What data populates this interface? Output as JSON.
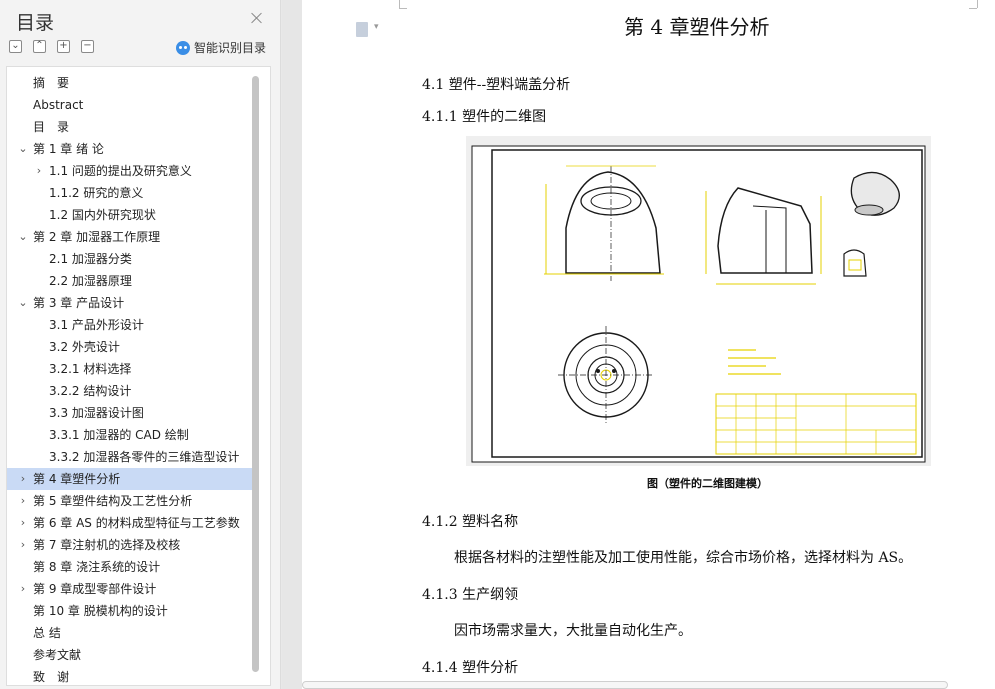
{
  "sidebar": {
    "title": "目录",
    "smart_toc_label": "智能识别目录",
    "tool_icons": [
      "collapse-all-icon",
      "expand-all-icon",
      "add-icon",
      "remove-icon"
    ],
    "items": [
      {
        "label": "摘　要",
        "level": 1,
        "toggle": "none"
      },
      {
        "label": "Abstract",
        "level": 1,
        "toggle": "none"
      },
      {
        "label": "目　录",
        "level": 1,
        "toggle": "none"
      },
      {
        "label": "第 1 章  绪  论",
        "level": 1,
        "toggle": "expanded"
      },
      {
        "label": "1.1 问题的提出及研究意义",
        "level": 2,
        "toggle": "collapsed"
      },
      {
        "label": "1.1.2 研究的意义",
        "level": 2,
        "toggle": "none"
      },
      {
        "label": "1.2 国内外研究现状",
        "level": 2,
        "toggle": "none"
      },
      {
        "label": "第 2 章  加湿器工作原理",
        "level": 1,
        "toggle": "expanded"
      },
      {
        "label": "2.1 加湿器分类",
        "level": 2,
        "toggle": "none"
      },
      {
        "label": "2.2 加湿器原理",
        "level": 2,
        "toggle": "none"
      },
      {
        "label": "第 3 章  产品设计",
        "level": 1,
        "toggle": "expanded"
      },
      {
        "label": "3.1  产品外形设计",
        "level": 2,
        "toggle": "none"
      },
      {
        "label": "3.2  外壳设计",
        "level": 2,
        "toggle": "none"
      },
      {
        "label": "3.2.1  材料选择",
        "level": 2,
        "toggle": "none"
      },
      {
        "label": "3.2.2  结构设计",
        "level": 2,
        "toggle": "none"
      },
      {
        "label": "3.3  加湿器设计图",
        "level": 2,
        "toggle": "none"
      },
      {
        "label": "3.3.1 加湿器的 CAD 绘制",
        "level": 2,
        "toggle": "none"
      },
      {
        "label": "3.3.2 加湿器各零件的三维造型设计",
        "level": 2,
        "toggle": "none"
      },
      {
        "label": "第 4 章塑件分析",
        "level": 1,
        "toggle": "collapsed",
        "selected": true
      },
      {
        "label": "第 5 章塑件结构及工艺性分析",
        "level": 1,
        "toggle": "collapsed"
      },
      {
        "label": "第 6 章  AS 的材料成型特征与工艺参数",
        "level": 1,
        "toggle": "collapsed"
      },
      {
        "label": "第 7 章注射机的选择及校核",
        "level": 1,
        "toggle": "collapsed"
      },
      {
        "label": "第 8 章  浇注系统的设计",
        "level": 1,
        "toggle": "none"
      },
      {
        "label": "第 9 章成型零部件设计",
        "level": 1,
        "toggle": "collapsed"
      },
      {
        "label": "第 10 章  脱模机构的设计",
        "level": 1,
        "toggle": "none"
      },
      {
        "label": "总  结",
        "level": 1,
        "toggle": "none"
      },
      {
        "label": "参考文献",
        "level": 1,
        "toggle": "none"
      },
      {
        "label": "致　谢",
        "level": 1,
        "toggle": "none"
      }
    ]
  },
  "document": {
    "chapter_title": "第 4 章塑件分析",
    "s41": "4.1 塑件--塑料端盖分析",
    "s411": "4.1.1 塑件的二维图",
    "figure_caption": "图（塑件的二维图建模）",
    "s412": "4.1.2 塑料名称",
    "p412": "根据各材料的注塑性能及加工使用性能，综合市场价格，选择材料为 AS。",
    "s413": "4.1.3 生产纲领",
    "p413": "因市场需求量大，大批量自动化生产。",
    "s414": "4.1.4 塑件分析"
  },
  "colors": {
    "cad_yellow": "#e6d200",
    "cad_black": "#1a1a1a",
    "selected_bg": "#c9daf5"
  }
}
